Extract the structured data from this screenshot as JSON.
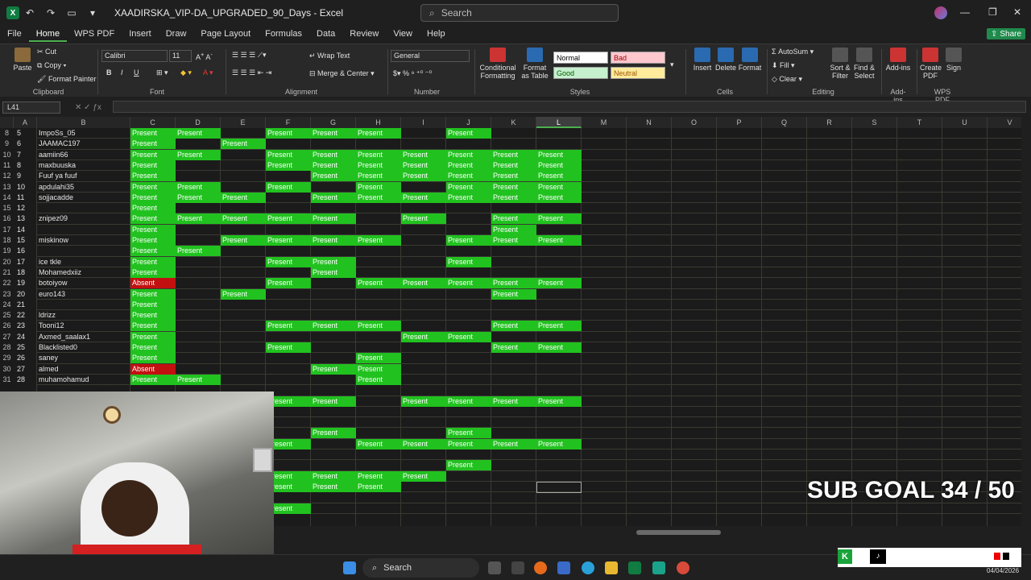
{
  "titlebar": {
    "doc_title": "XAADIRSKA_VIP-DA_UPGRADED_90_Days  -  Excel",
    "search_placeholder": "Search"
  },
  "menu": [
    "File",
    "Home",
    "WPS PDF",
    "Insert",
    "Draw",
    "Page Layout",
    "Formulas",
    "Data",
    "Review",
    "View",
    "Help"
  ],
  "share_label": "Share",
  "ribbon": {
    "paste": "Paste",
    "cut": "Cut",
    "copy": "Copy",
    "format_painter": "Format Painter",
    "font_name": "Calibri",
    "font_size": "11",
    "wrap_text": "Wrap Text",
    "merge_center": "Merge & Center",
    "number_format": "General",
    "conditional_formatting": "Conditional Formatting",
    "format_as_table": "Format as Table",
    "style_normal": "Normal",
    "style_bad": "Bad",
    "style_good": "Good",
    "style_neutral": "Neutral",
    "insert": "Insert",
    "delete": "Delete",
    "format": "Format",
    "autosum": "AutoSum",
    "fill": "Fill",
    "clear": "Clear",
    "sort_filter": "Sort & Filter",
    "find_select": "Find & Select",
    "addins": "Add-ins",
    "create_pdf": "Create PDF",
    "sign": "Sign",
    "groups": {
      "clipboard": "Clipboard",
      "font": "Font",
      "alignment": "Alignment",
      "number": "Number",
      "styles": "Styles",
      "cells": "Cells",
      "editing": "Editing",
      "addins": "Add-ins",
      "wps_pdf": "WPS PDF"
    }
  },
  "namebox": "L41",
  "columns": [
    "A",
    "B",
    "C",
    "D",
    "E",
    "F",
    "G",
    "H",
    "I",
    "J",
    "K",
    "L",
    "M",
    "N",
    "O",
    "P",
    "Q",
    "R",
    "S",
    "T",
    "U",
    "V"
  ],
  "rows": [
    {
      "r": "8",
      "a": "5",
      "b": "ImpoSs_05",
      "cells": {
        "C": "P",
        "D": "P",
        "F": "P",
        "G": "P",
        "H": "P",
        "J": "P"
      }
    },
    {
      "r": "9",
      "a": "6",
      "b": "JAAMAC197",
      "cells": {
        "C": "P",
        "E": "P"
      }
    },
    {
      "r": "10",
      "a": "7",
      "b": "aamiin66",
      "cells": {
        "C": "P",
        "D": "P",
        "F": "P",
        "G": "P",
        "H": "P",
        "I": "P",
        "J": "P",
        "K": "P",
        "L": "P"
      }
    },
    {
      "r": "11",
      "a": "8",
      "b": "maxbuuska",
      "cells": {
        "C": "P",
        "F": "P",
        "G": "P",
        "H": "P",
        "I": "P",
        "J": "P",
        "K": "P",
        "L": "P"
      }
    },
    {
      "r": "12",
      "a": "9",
      "b": "Fuuf ya fuuf",
      "cells": {
        "C": "P",
        "G": "P",
        "H": "P",
        "I": "P",
        "J": "P",
        "K": "P",
        "L": "P"
      }
    },
    {
      "r": "13",
      "a": "10",
      "b": "apdulahi35",
      "cells": {
        "C": "P",
        "D": "P",
        "F": "P",
        "H": "P",
        "J": "P",
        "K": "P",
        "L": "P"
      }
    },
    {
      "r": "14",
      "a": "11",
      "b": "sojjacadde",
      "cells": {
        "C": "P",
        "D": "P",
        "E": "P",
        "G": "P",
        "H": "P",
        "I": "P",
        "J": "P",
        "K": "P",
        "L": "P"
      }
    },
    {
      "r": "15",
      "a": "12",
      "b": "",
      "cells": {
        "C": "P"
      }
    },
    {
      "r": "16",
      "a": "13",
      "b": "znipez09",
      "cells": {
        "C": "P",
        "D": "P",
        "E": "P",
        "F": "P",
        "G": "P",
        "I": "P",
        "K": "P",
        "L": "P"
      }
    },
    {
      "r": "17",
      "a": "14",
      "b": "",
      "cells": {
        "C": "P",
        "K": "P"
      }
    },
    {
      "r": "18",
      "a": "15",
      "b": "miskinow",
      "cells": {
        "C": "P",
        "E": "P",
        "F": "P",
        "G": "P",
        "H": "P",
        "J": "P",
        "K": "P",
        "L": "P"
      }
    },
    {
      "r": "19",
      "a": "16",
      "b": "",
      "cells": {
        "C": "P",
        "D": "P"
      }
    },
    {
      "r": "20",
      "a": "17",
      "b": "ice tkle",
      "cells": {
        "C": "P",
        "F": "P",
        "G": "P",
        "J": "P"
      }
    },
    {
      "r": "21",
      "a": "18",
      "b": "Mohamedxiiz",
      "cells": {
        "C": "P",
        "G": "P"
      }
    },
    {
      "r": "22",
      "a": "19",
      "b": "botoiyow",
      "cells": {
        "C": "A",
        "F": "P",
        "H": "P",
        "I": "P",
        "J": "P",
        "K": "P",
        "L": "P"
      }
    },
    {
      "r": "23",
      "a": "20",
      "b": "euro143",
      "cells": {
        "C": "P",
        "E": "P",
        "K": "P"
      }
    },
    {
      "r": "24",
      "a": "21",
      "b": "",
      "cells": {
        "C": "P"
      }
    },
    {
      "r": "25",
      "a": "22",
      "b": "ldrizz",
      "cells": {
        "C": "P"
      }
    },
    {
      "r": "26",
      "a": "23",
      "b": "Tooni12",
      "cells": {
        "C": "P",
        "F": "P",
        "G": "P",
        "H": "P",
        "K": "P",
        "L": "P"
      }
    },
    {
      "r": "27",
      "a": "24",
      "b": "Axmed_saalax1",
      "cells": {
        "C": "P",
        "I": "P",
        "J": "P"
      }
    },
    {
      "r": "28",
      "a": "25",
      "b": "Blacklisted0",
      "cells": {
        "C": "P",
        "F": "P",
        "K": "P",
        "L": "P"
      }
    },
    {
      "r": "29",
      "a": "26",
      "b": "saney",
      "cells": {
        "C": "P",
        "H": "P"
      }
    },
    {
      "r": "30",
      "a": "27",
      "b": "almed",
      "cells": {
        "C": "A",
        "G": "P",
        "H": "P"
      }
    },
    {
      "r": "31",
      "a": "28",
      "b": "muhamohamud",
      "cells": {
        "C": "P",
        "D": "P",
        "H": "P"
      }
    },
    {
      "r": "",
      "a": "",
      "b": "",
      "cells": {}
    },
    {
      "r": "",
      "a": "",
      "b": "",
      "cells": {
        "F": "P",
        "G": "P",
        "I": "P",
        "J": "P",
        "K": "P",
        "L": "P"
      }
    },
    {
      "r": "",
      "a": "",
      "b": "",
      "cells": {}
    },
    {
      "r": "",
      "a": "",
      "b": "",
      "cells": {}
    },
    {
      "r": "",
      "a": "",
      "b": "",
      "cells": {
        "G": "P",
        "J": "P"
      }
    },
    {
      "r": "",
      "a": "",
      "b": "",
      "cells": {
        "F": "P",
        "H": "P",
        "I": "P",
        "J": "P",
        "K": "P",
        "L": "P"
      }
    },
    {
      "r": "",
      "a": "",
      "b": "",
      "cells": {}
    },
    {
      "r": "",
      "a": "",
      "b": "",
      "cells": {
        "J": "P"
      }
    },
    {
      "r": "",
      "a": "",
      "b": "",
      "cells": {
        "F": "P",
        "G": "P",
        "H": "P",
        "I": "P"
      }
    },
    {
      "r": "",
      "a": "",
      "b": "",
      "cells": {
        "F": "P",
        "G": "P",
        "H": "P"
      }
    },
    {
      "r": "",
      "a": "",
      "b": "",
      "cells": {}
    },
    {
      "r": "",
      "a": "",
      "b": "",
      "cells": {
        "F": "P"
      }
    }
  ],
  "cell_text": {
    "P": "Present",
    "A": "Absent",
    "P_partial": "esent"
  },
  "overlay": {
    "sub_goal": "SUB GOAL 34 / 50"
  },
  "taskbar": {
    "search": "Search",
    "date": "04/04/2026"
  },
  "colors": {
    "present": "#21c21f",
    "absent": "#c21010",
    "accent": "#107c41"
  }
}
